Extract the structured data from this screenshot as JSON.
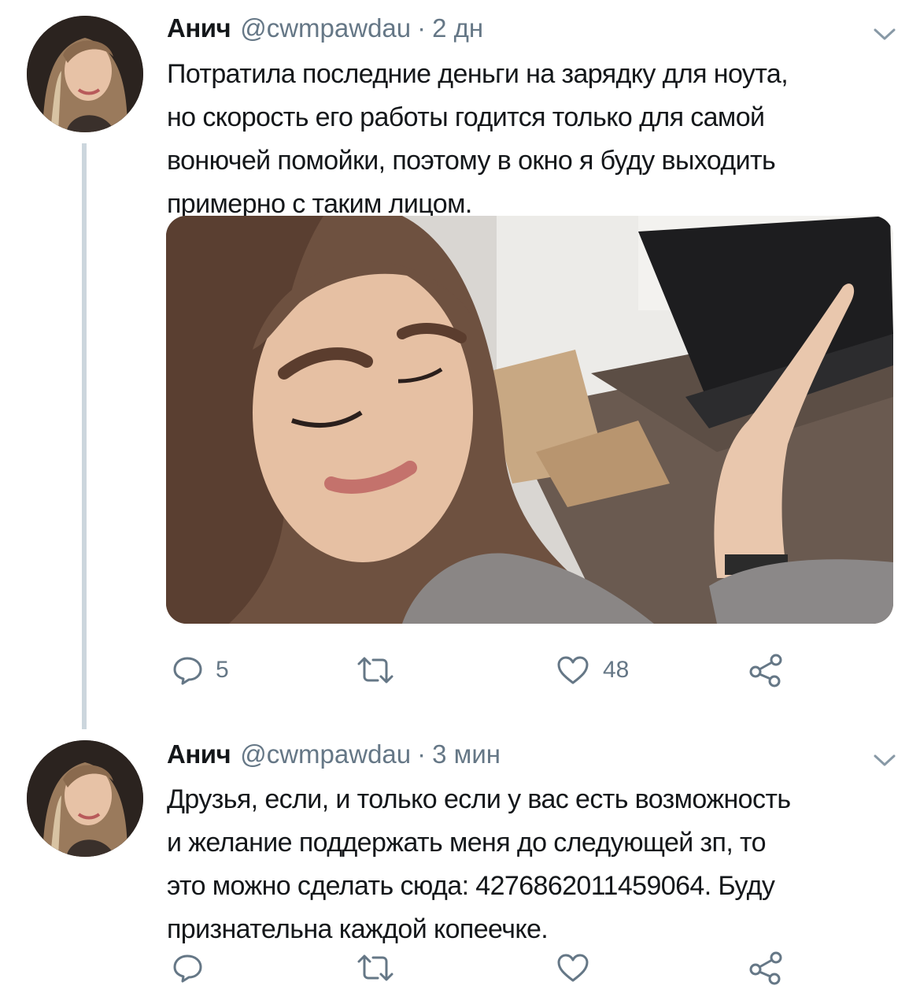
{
  "tweets": [
    {
      "author": {
        "name": "Анич",
        "handle": "@cwmpawdau"
      },
      "separator": "·",
      "time": "2 дн",
      "text": "Потратила последние деньги на зарядку для ноута,\nно скорость его работы годится только для самой\nвонючей помойки, поэтому в окно я буду выходить\nпримерно с таким лицом.",
      "actions": {
        "replies": "5",
        "retweets": "",
        "likes": "48"
      }
    },
    {
      "author": {
        "name": "Анич",
        "handle": "@cwmpawdau"
      },
      "separator": "·",
      "time": "3 мин",
      "text": "Друзья, если, и только если у вас есть возможность\nи желание поддержать меня до следующей зп, то\nэто можно сделать сюда: 4276862011459064. Буду\nпризнательна каждой копеечке.",
      "actions": {
        "replies": "",
        "retweets": "",
        "likes": ""
      }
    }
  ],
  "icons": [
    "avatar",
    "chevron-down-icon",
    "reply-icon",
    "retweet-icon",
    "like-icon",
    "share-icon"
  ],
  "colors": {
    "text": "#14171a",
    "secondary": "#657786",
    "thread_line": "#ccd6dd"
  }
}
